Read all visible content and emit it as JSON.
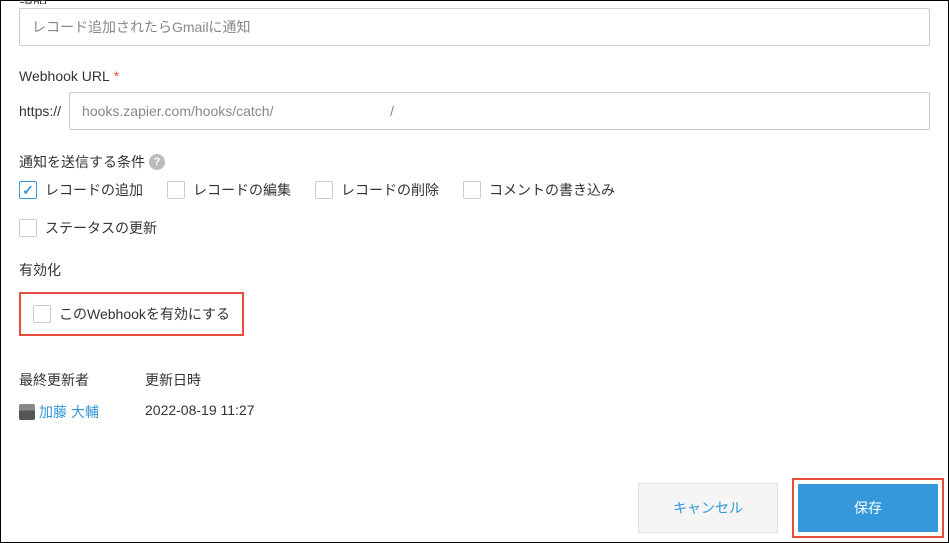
{
  "description": {
    "label": "説明",
    "value": "レコード追加されたらGmailに通知"
  },
  "webhook": {
    "label": "Webhook URL",
    "prefix": "https://",
    "value": "hooks.zapier.com/hooks/catch/                              /"
  },
  "conditions": {
    "label": "通知を送信する条件",
    "items": [
      {
        "label": "レコードの追加",
        "checked": true
      },
      {
        "label": "レコードの編集",
        "checked": false
      },
      {
        "label": "レコードの削除",
        "checked": false
      },
      {
        "label": "コメントの書き込み",
        "checked": false
      },
      {
        "label": "ステータスの更新",
        "checked": false
      }
    ]
  },
  "activation": {
    "label": "有効化",
    "checkbox_label": "このWebhookを有効にする",
    "checked": false
  },
  "info": {
    "updater_label": "最終更新者",
    "updater_name": "加藤 大輔",
    "datetime_label": "更新日時",
    "datetime_value": "2022-08-19 11:27"
  },
  "buttons": {
    "cancel": "キャンセル",
    "save": "保存"
  }
}
